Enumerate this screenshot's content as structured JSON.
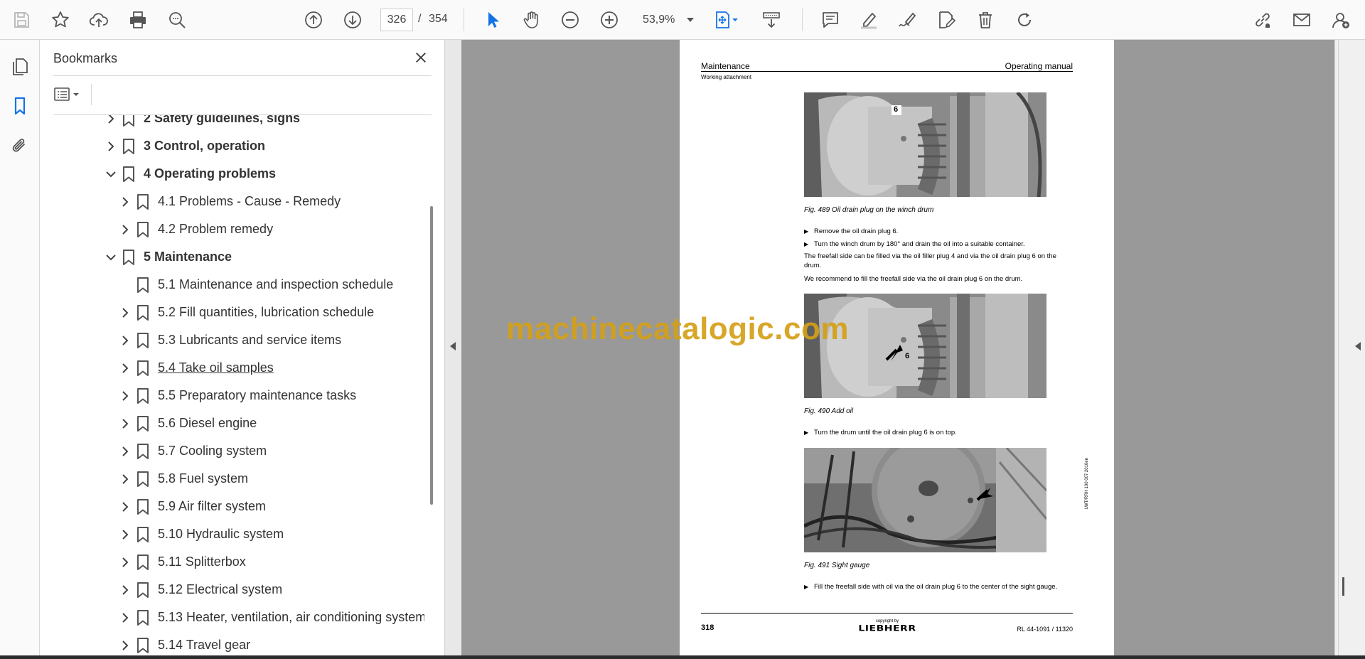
{
  "toolbar": {
    "page_current": "326",
    "page_separator": "/",
    "page_total": "354",
    "zoom": "53,9%"
  },
  "bookmarks": {
    "title": "Bookmarks",
    "items": [
      {
        "label": "2 Safety guidelines, signs",
        "level": 1,
        "expander": "collapsed",
        "bold": true
      },
      {
        "label": "3 Control, operation",
        "level": 1,
        "expander": "collapsed",
        "bold": true
      },
      {
        "label": "4 Operating problems",
        "level": 1,
        "expander": "expanded",
        "bold": true
      },
      {
        "label": "4.1 Problems - Cause - Remedy",
        "level": 2,
        "expander": "collapsed",
        "bold": false
      },
      {
        "label": "4.2 Problem remedy",
        "level": 2,
        "expander": "collapsed",
        "bold": false
      },
      {
        "label": "5 Maintenance",
        "level": 1,
        "expander": "expanded",
        "bold": true
      },
      {
        "label": "5.1 Maintenance and inspection schedule",
        "level": 2,
        "expander": "none",
        "bold": false
      },
      {
        "label": "5.2 Fill quantities, lubrication schedule",
        "level": 2,
        "expander": "collapsed",
        "bold": false
      },
      {
        "label": "5.3 Lubricants and service items",
        "level": 2,
        "expander": "collapsed",
        "bold": false
      },
      {
        "label": "5.4 Take oil samples",
        "level": 2,
        "expander": "collapsed",
        "bold": false,
        "underline": true
      },
      {
        "label": "5.5 Preparatory maintenance tasks",
        "level": 2,
        "expander": "collapsed",
        "bold": false
      },
      {
        "label": "5.6 Diesel engine",
        "level": 2,
        "expander": "collapsed",
        "bold": false
      },
      {
        "label": "5.7 Cooling system",
        "level": 2,
        "expander": "collapsed",
        "bold": false
      },
      {
        "label": "5.8 Fuel system",
        "level": 2,
        "expander": "collapsed",
        "bold": false
      },
      {
        "label": "5.9 Air filter system",
        "level": 2,
        "expander": "collapsed",
        "bold": false
      },
      {
        "label": "5.10 Hydraulic system",
        "level": 2,
        "expander": "collapsed",
        "bold": false
      },
      {
        "label": "5.11 Splitterbox",
        "level": 2,
        "expander": "collapsed",
        "bold": false
      },
      {
        "label": "5.12 Electrical system",
        "level": 2,
        "expander": "collapsed",
        "bold": false
      },
      {
        "label": "5.13 Heater, ventilation, air conditioning system",
        "level": 2,
        "expander": "collapsed",
        "bold": false
      },
      {
        "label": "5.14 Travel gear",
        "level": 2,
        "expander": "collapsed",
        "bold": false
      }
    ]
  },
  "page": {
    "header_left": "Maintenance",
    "header_right": "Operating manual",
    "subheader": "Working attachment",
    "fig489_label": "6",
    "fig489_caption": "Fig. 489 Oil drain plug on the winch drum",
    "bullet1": "Remove the oil drain plug 6.",
    "bullet2": "Turn the winch drum by 180° and drain the oil into a suitable container.",
    "para1": "The freefall side can be filled via the oil filler plug 4 and via the oil drain plug 6 on the drum.",
    "para2": "We recommend to fill the freefall side via the oil drain plug 6 on the drum.",
    "fig490_label": "6",
    "fig490_caption": "Fig. 490 Add oil",
    "bullet3": "Turn the drum until the oil drain plug 6 is on top.",
    "fig491_caption": "Fig. 491 Sight gauge",
    "bullet4": "Fill the freefall side with oil via the oil drain plug 6 to the center of the sight gauge.",
    "footer_page": "318",
    "footer_copyright": "copyright by",
    "footer_logo": "LIEBHERR",
    "footer_ref": "RL 44-1091 / 11320",
    "side_code": "LWT/RRH 100 007 2010en"
  },
  "watermark": "machinecatalogic.com",
  "colors": {
    "accent_blue": "#1473e6",
    "doc_background": "#999999",
    "watermark": "#d4a017"
  }
}
